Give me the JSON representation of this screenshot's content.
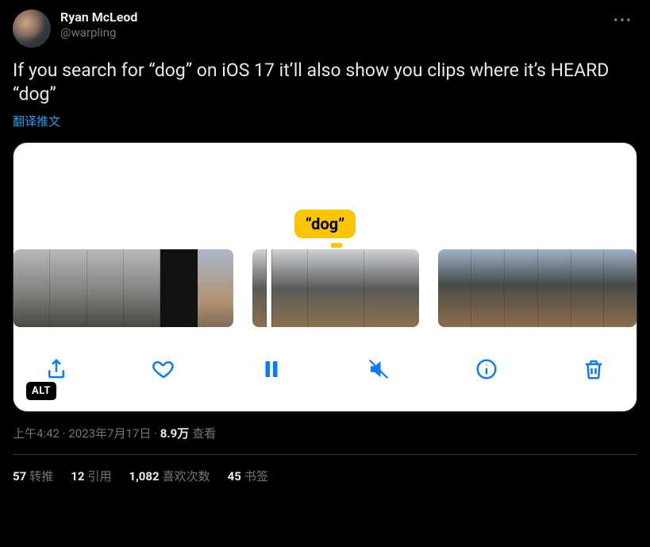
{
  "author": {
    "display_name": "Ryan McLeod",
    "handle": "@warpling"
  },
  "tweet_text": "If you search for “dog” on iOS 17 it’ll also show you clips where it’s HEARD “dog”",
  "translate_label": "翻译推文",
  "media": {
    "caption_text": "“dog”",
    "alt_badge": "ALT",
    "toolbar": {
      "share": "share",
      "like": "like",
      "pause": "pause",
      "mute": "mute",
      "info": "info",
      "trash": "trash"
    }
  },
  "meta": {
    "time": "上午4:42",
    "date": "2023年7月17日",
    "views_num": "8.9万",
    "views_label": "查看"
  },
  "stats": {
    "retweets": {
      "num": "57",
      "label": "转推"
    },
    "quotes": {
      "num": "12",
      "label": "引用"
    },
    "likes": {
      "num": "1,082",
      "label": "喜欢次数"
    },
    "bookmarks": {
      "num": "45",
      "label": "书签"
    }
  }
}
